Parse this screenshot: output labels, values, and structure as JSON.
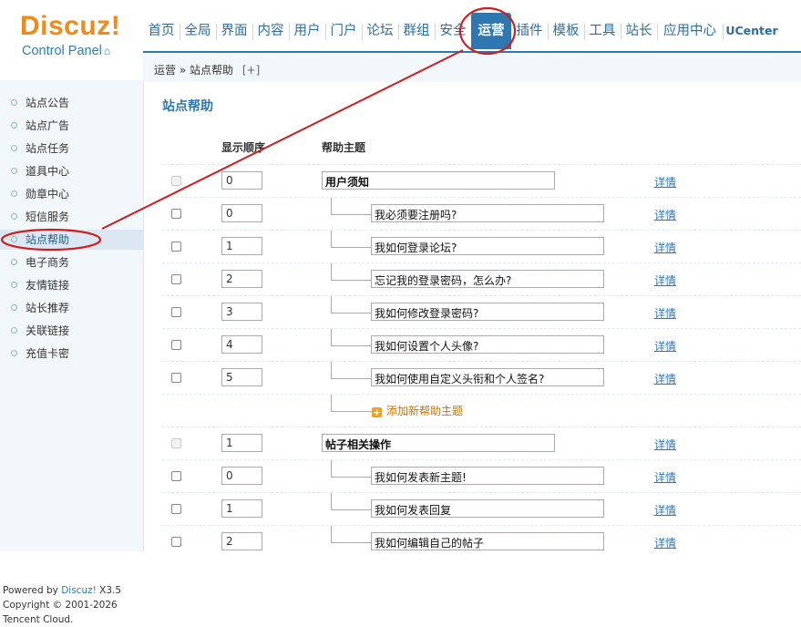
{
  "logo": {
    "brand": "Discuz!",
    "subtitle": "Control Panel"
  },
  "nav": {
    "items": [
      {
        "label": "首页",
        "active": false
      },
      {
        "label": "全局",
        "active": false
      },
      {
        "label": "界面",
        "active": false
      },
      {
        "label": "内容",
        "active": false
      },
      {
        "label": "用户",
        "active": false
      },
      {
        "label": "门户",
        "active": false
      },
      {
        "label": "论坛",
        "active": false
      },
      {
        "label": "群组",
        "active": false
      },
      {
        "label": "安全",
        "active": false
      },
      {
        "label": "运营",
        "active": true
      },
      {
        "label": "插件",
        "active": false
      },
      {
        "label": "模板",
        "active": false
      },
      {
        "label": "工具",
        "active": false
      },
      {
        "label": "站长",
        "active": false
      },
      {
        "label": "应用中心",
        "active": false
      },
      {
        "label": "UCenter",
        "active": false
      }
    ]
  },
  "breadcrumb": {
    "parent": "运营",
    "separator": "»",
    "current": "站点帮助",
    "add": "[+]"
  },
  "sidebar": {
    "items": [
      {
        "label": "站点公告",
        "active": false
      },
      {
        "label": "站点广告",
        "active": false
      },
      {
        "label": "站点任务",
        "active": false
      },
      {
        "label": "道具中心",
        "active": false
      },
      {
        "label": "勋章中心",
        "active": false
      },
      {
        "label": "短信服务",
        "active": false
      },
      {
        "label": "站点帮助",
        "active": true
      },
      {
        "label": "电子商务",
        "active": false
      },
      {
        "label": "友情链接",
        "active": false
      },
      {
        "label": "站长推荐",
        "active": false
      },
      {
        "label": "关联链接",
        "active": false
      },
      {
        "label": "充值卡密",
        "active": false
      }
    ],
    "footer": {
      "powered_prefix": "Powered by ",
      "powered_brand": "Discuz!",
      "powered_version": " X3.5",
      "copyright": "Copyright © 2001-2026",
      "company": "Tencent Cloud."
    }
  },
  "main": {
    "title": "站点帮助",
    "columns": {
      "order": "显示顺序",
      "topic": "帮助主题"
    },
    "detail_label": "详情",
    "add_label": "添加新帮助主题",
    "rows": [
      {
        "type": "category",
        "order": "0",
        "title": "用户须知"
      },
      {
        "type": "item",
        "order": "0",
        "title": "我必须要注册吗?"
      },
      {
        "type": "item",
        "order": "1",
        "title": "我如何登录论坛?"
      },
      {
        "type": "item",
        "order": "2",
        "title": "忘记我的登录密码，怎么办?"
      },
      {
        "type": "item",
        "order": "3",
        "title": "我如何修改登录密码?"
      },
      {
        "type": "item",
        "order": "4",
        "title": "我如何设置个人头像?"
      },
      {
        "type": "item",
        "order": "5",
        "title": "我如何使用自定义头衔和个人签名?"
      },
      {
        "type": "add"
      },
      {
        "type": "category",
        "order": "1",
        "title": "帖子相关操作"
      },
      {
        "type": "item",
        "order": "0",
        "title": "我如何发表新主题!"
      },
      {
        "type": "item",
        "order": "1",
        "title": "我如何发表回复"
      },
      {
        "type": "item",
        "order": "2",
        "title": "我如何编辑自己的帖子"
      }
    ]
  },
  "colors": {
    "accent": "#2f77b0",
    "logo": "#f08a1a",
    "annotation": "#cc1f1f"
  }
}
